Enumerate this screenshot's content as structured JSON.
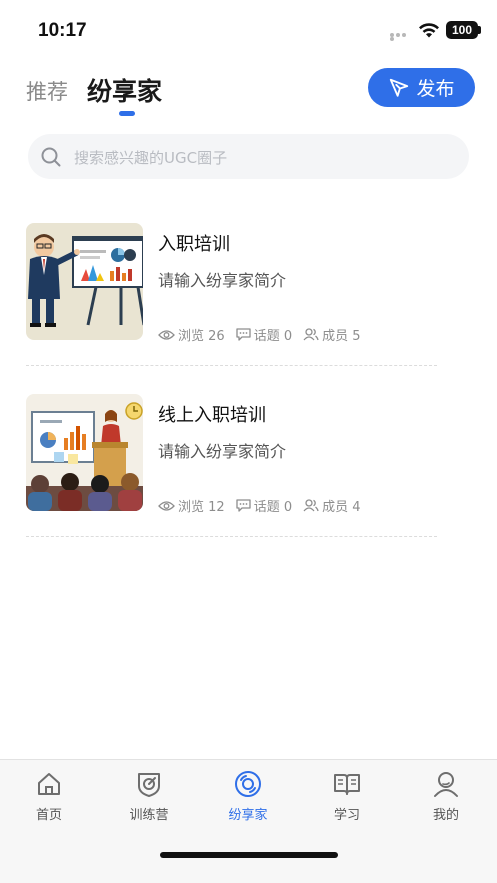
{
  "status_bar": {
    "time": "10:17",
    "battery": "100"
  },
  "header": {
    "tabs": [
      {
        "label": "推荐",
        "active": false
      },
      {
        "label": "纷享家",
        "active": true
      }
    ],
    "publish_label": "发布",
    "accent": "#2f6fe8"
  },
  "search": {
    "placeholder": "搜索感兴趣的UGC圈子"
  },
  "circles": [
    {
      "title": "入职培训",
      "description": "请输入纷享家简介",
      "stats": {
        "views": "浏览 26",
        "topics": "话题 0",
        "members": "成员 5"
      },
      "thumbnail_icon": "presenter-with-chart-illustration"
    },
    {
      "title": "线上入职培训",
      "description": "请输入纷享家简介",
      "stats": {
        "views": "浏览 12",
        "topics": "话题 0",
        "members": "成员 4"
      },
      "thumbnail_icon": "lecture-audience-illustration"
    }
  ],
  "tabbar": {
    "items": [
      {
        "label": "首页",
        "icon": "home-icon",
        "active": false
      },
      {
        "label": "训练营",
        "icon": "target-shield-icon",
        "active": false
      },
      {
        "label": "纷享家",
        "icon": "disc-icon",
        "active": true
      },
      {
        "label": "学习",
        "icon": "book-icon",
        "active": false
      },
      {
        "label": "我的",
        "icon": "user-icon",
        "active": false
      }
    ]
  }
}
